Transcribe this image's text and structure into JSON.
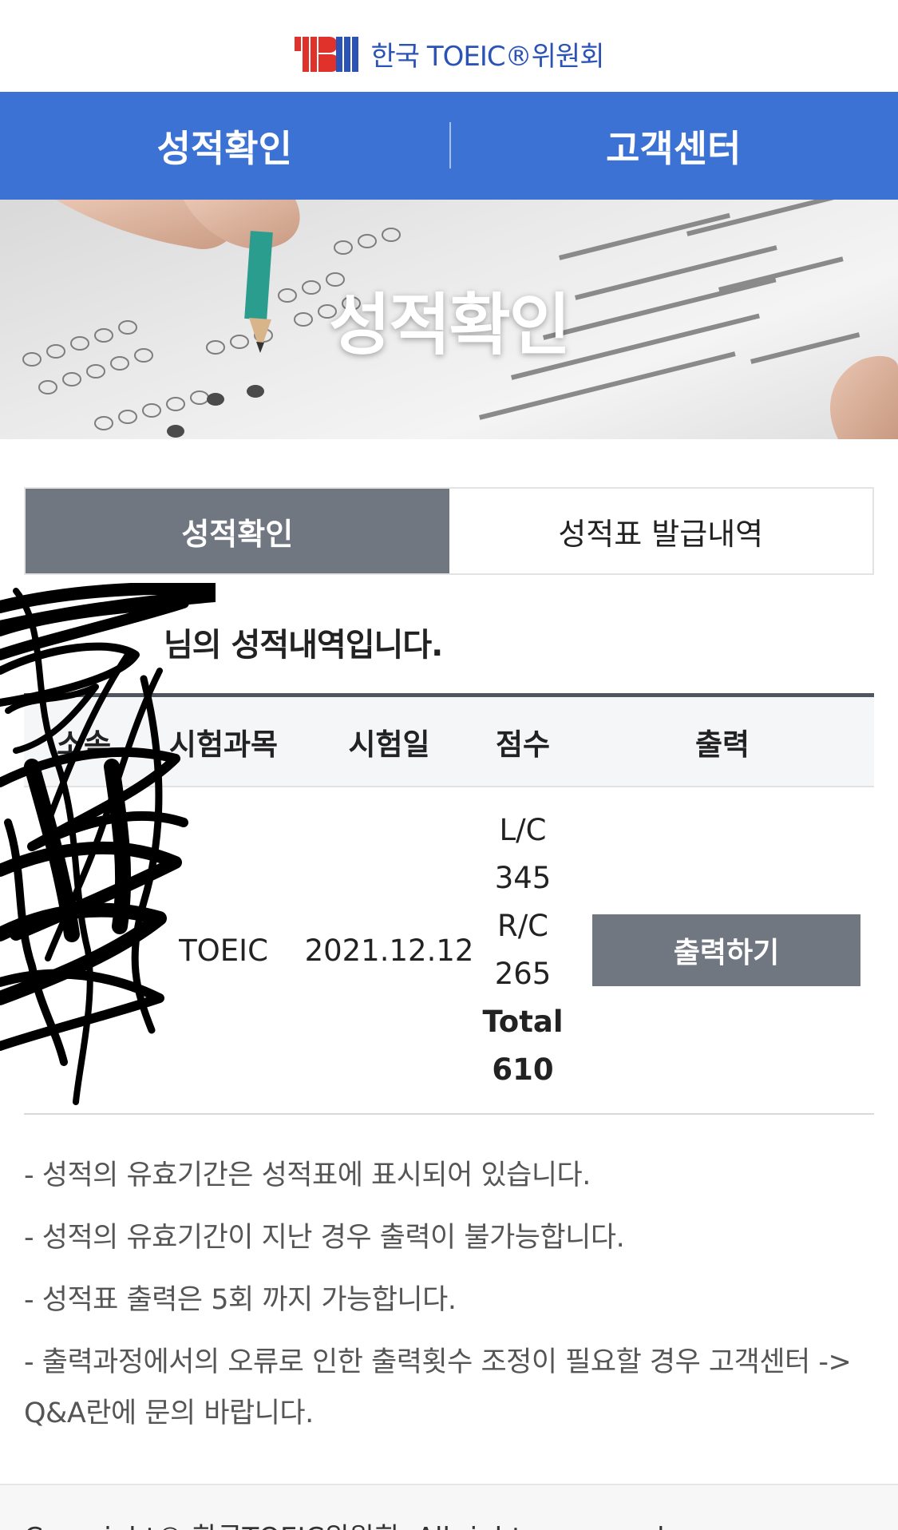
{
  "header": {
    "logo_mark_text": "YBM",
    "logo_text": "한국 TOEIC®위원회"
  },
  "top_nav": {
    "items": [
      {
        "label": "성적확인"
      },
      {
        "label": "고객센터"
      }
    ]
  },
  "hero": {
    "title": "성적확인"
  },
  "sub_tabs": {
    "items": [
      {
        "label": "성적확인",
        "active": true
      },
      {
        "label": "성적표 발급내역",
        "active": false
      }
    ]
  },
  "result": {
    "heading": "님의 성적내역입니다.",
    "columns": [
      "소속",
      "시험과목",
      "시험일",
      "점수",
      "출력"
    ],
    "rows": [
      {
        "affiliation": "",
        "subject": "TOEIC",
        "date": "2021.12.12",
        "lc_label": "L/C",
        "lc_score": "345",
        "rc_label": "R/C",
        "rc_score": "265",
        "total_label": "Total",
        "total_score": "610",
        "print_label": "출력하기"
      }
    ]
  },
  "notices": [
    "- 성적의 유효기간은 성적표에 표시되어 있습니다.",
    "- 성적의 유효기간이 지난 경우 출력이 불가능합니다.",
    "- 성적표 출력은 5회 까지 가능합니다.",
    "- 출력과정에서의 오류로 인한 출력횟수 조정이 필요할 경우 고객센터 -> Q&A란에 문의 바랍니다."
  ],
  "footer": {
    "copyright": "Copyright© 한국TOEIC위원회. All rights reserved."
  },
  "colors": {
    "brand_blue": "#3b72d4",
    "logo_red": "#e0322b",
    "logo_blue": "#2b53b5",
    "gray_button": "#707781"
  }
}
